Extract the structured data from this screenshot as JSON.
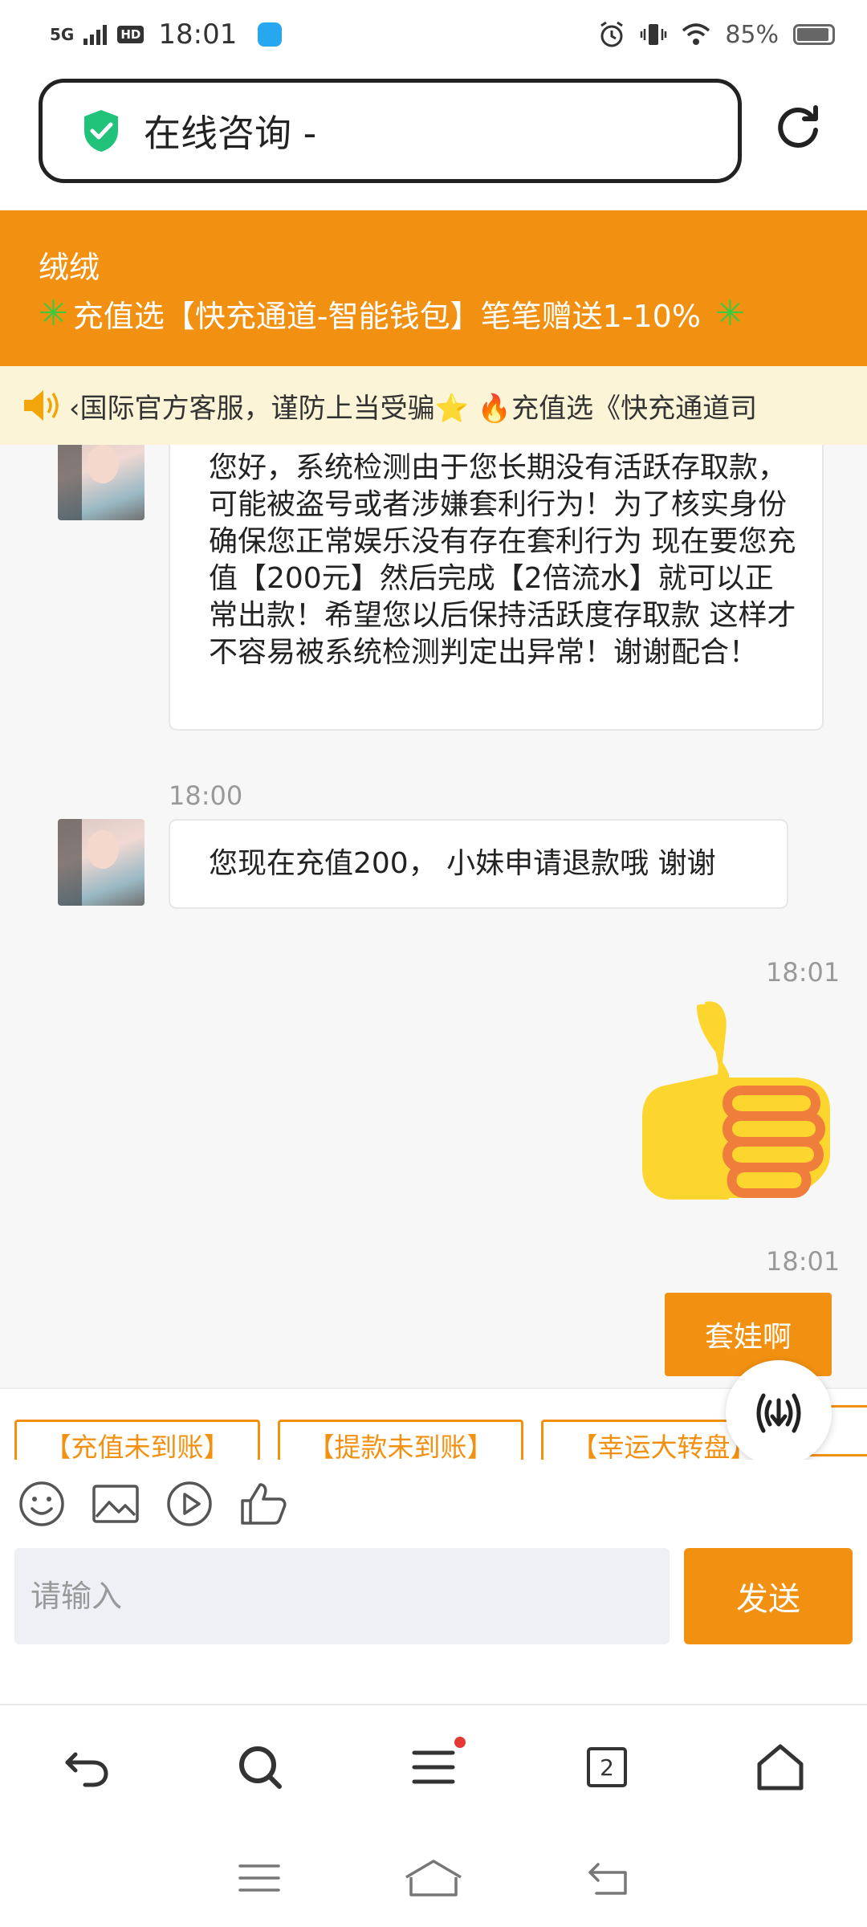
{
  "status_bar": {
    "network": "5G",
    "hd": "HD",
    "time": "18:01",
    "battery": "85%"
  },
  "url_bar": {
    "title": "在线咨询 -"
  },
  "header": {
    "name": "绒绒",
    "promo": "充值选【快充通道-智能钱包】笔笔赠送1-10%"
  },
  "marquee": {
    "text": "‹国际官方客服，谨防上当受骗⭐ 🔥充值选《快充通道司"
  },
  "messages": [
    {
      "sender": "agent",
      "text": "您好，系统检测由于您长期没有活跃存取款，可能被盗号或者涉嫌套利行为！为了核实身份 确保您正常娱乐没有存在套利行为 现在要您充值【200元】然后完成【2倍流水】就可以正常出款！希望您以后保持活跃度存取款 这样才不容易被系统检测判定出异常！谢谢配合！"
    },
    {
      "sender": "agent",
      "time": "18:00",
      "text": "您现在充值200， 小妹申请退款哦 谢谢"
    },
    {
      "sender": "user",
      "time": "18:01",
      "type": "emoji",
      "emoji": "thumbs-up"
    },
    {
      "sender": "user",
      "time": "18:01",
      "text": "套娃啊"
    }
  ],
  "quick_replies": [
    "【充值未到账】",
    "【提款未到账】",
    "【幸运大转盘】"
  ],
  "input": {
    "placeholder": "请输入",
    "send_label": "发送"
  },
  "browser_nav": {
    "tabs_count": "2"
  },
  "colors": {
    "accent": "#f29111",
    "marquee_bg": "#fcf4d6",
    "shield": "#21c27a"
  }
}
